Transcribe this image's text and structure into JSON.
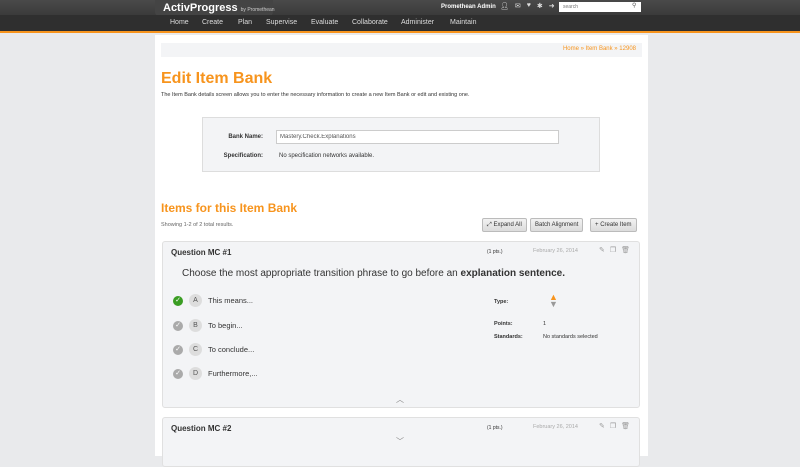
{
  "header": {
    "logo": "ActivProgress",
    "logo_sub": "by Promethean",
    "user": "Promethean Admin",
    "search_placeholder": "search",
    "nav": [
      "Home",
      "Create",
      "Plan",
      "Supervise",
      "Evaluate",
      "Collaborate",
      "Administer",
      "Maintain"
    ]
  },
  "breadcrumb": "Home » Item Bank » 12908",
  "title": "Edit Item Bank",
  "description": "The Item Bank details screen allows you to enter the necessary information to create a new Item Bank or edit and existing one.",
  "form": {
    "bank_name_label": "Bank Name:",
    "bank_name_value": "Mastery.Check.Explanations",
    "spec_label": "Specification:",
    "spec_value": "No specification networks available."
  },
  "items": {
    "heading": "Items for this Item Bank",
    "showing": "Showing 1-2 of 2 total results.",
    "expand_all": "Expand All",
    "batch_alignment": "Batch Alignment",
    "create_item": "Create Item"
  },
  "questions": [
    {
      "title": "Question MC #1",
      "points_badge": "(1 pts.)",
      "date": "February 26, 2014",
      "stem": "Choose the most appropriate transition phrase to go before an ",
      "stem_bold": "explanation sentence.",
      "options": [
        {
          "letter": "A",
          "text": "This means...",
          "correct": true
        },
        {
          "letter": "B",
          "text": "To begin...",
          "correct": false
        },
        {
          "letter": "C",
          "text": "To conclude...",
          "correct": false
        },
        {
          "letter": "D",
          "text": "Furthermore,...",
          "correct": false
        }
      ],
      "type_label": "Type:",
      "points_label": "Points:",
      "points": "1",
      "standards_label": "Standards:",
      "standards": "No standards selected"
    },
    {
      "title": "Question MC #2",
      "points_badge": "(1 pts.)",
      "date": "February 26, 2014"
    }
  ]
}
